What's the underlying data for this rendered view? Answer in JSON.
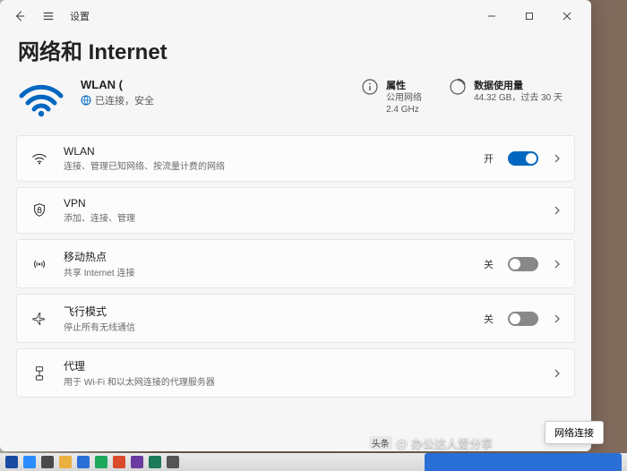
{
  "titlebar": {
    "app_name": "设置"
  },
  "page": {
    "title": "网络和 Internet"
  },
  "connection": {
    "name": "WLAN (",
    "status": "已连接，安全"
  },
  "props": {
    "label": "属性",
    "line1": "公用网络",
    "line2": "2.4 GHz"
  },
  "usage": {
    "label": "数据使用量",
    "line1": "44.32 GB，过去 30 天"
  },
  "items": {
    "wlan": {
      "title": "WLAN",
      "sub": "连接、管理已知网络、按流量计费的网络",
      "state": "开"
    },
    "vpn": {
      "title": "VPN",
      "sub": "添加、连接、管理"
    },
    "hotspot": {
      "title": "移动热点",
      "sub": "共享 Internet 连接",
      "state": "关"
    },
    "airplane": {
      "title": "飞行模式",
      "sub": "停止所有无线通信",
      "state": "关"
    },
    "proxy": {
      "title": "代理",
      "sub": "用于 Wi-Fi 和以太网连接的代理服务器"
    }
  },
  "tooltip": "网络连接",
  "watermark": {
    "prefix": "头条",
    "text": "办公达人爱分享"
  }
}
